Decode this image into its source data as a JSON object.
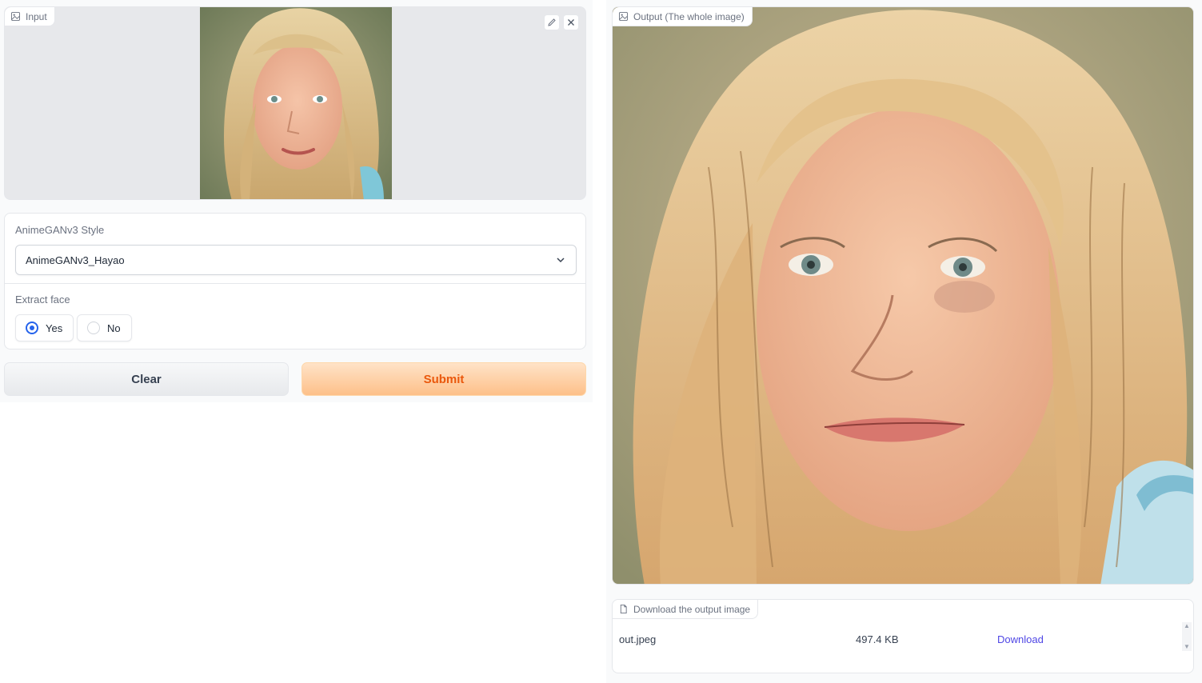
{
  "input": {
    "label": "Input"
  },
  "style": {
    "label": "AnimeGANv3 Style",
    "selected": "AnimeGANv3_Hayao"
  },
  "extract_face": {
    "label": "Extract face",
    "options": [
      "Yes",
      "No"
    ],
    "selected": "Yes"
  },
  "actions": {
    "clear": "Clear",
    "submit": "Submit"
  },
  "output": {
    "label": "Output (The whole image)"
  },
  "download": {
    "label": "Download the output image",
    "file_name": "out.jpeg",
    "file_size": "497.4 KB",
    "link": "Download"
  },
  "colors": {
    "accent": "#2563eb",
    "submit_text": "#ea580c",
    "link": "#4f46e5"
  },
  "icons": [
    "image-icon",
    "edit-icon",
    "close-icon",
    "chevron-down-icon",
    "file-icon"
  ]
}
